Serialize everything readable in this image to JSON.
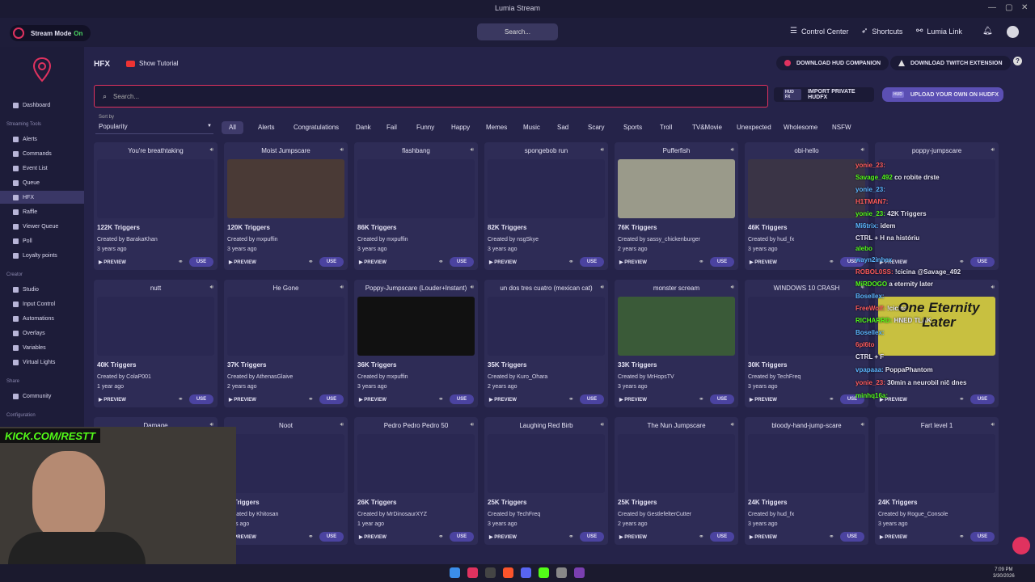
{
  "window": {
    "title": "Lumia Stream"
  },
  "topbar": {
    "stream_mode_label": "Stream Mode",
    "stream_mode_state": "On",
    "search_label": "Search...",
    "control_center": "Control Center",
    "shortcuts": "Shortcuts",
    "lumia_link": "Lumia Link"
  },
  "sidebar": {
    "dashboard": "Dashboard",
    "streaming_tools_header": "Streaming Tools",
    "streaming_tools": [
      "Alerts",
      "Commands",
      "Event List",
      "Queue",
      "HFX",
      "Raffle",
      "Viewer Queue",
      "Poll",
      "Loyalty points"
    ],
    "creator_header": "Creator",
    "creator": [
      "Studio",
      "Input Control",
      "Automations",
      "Overlays",
      "Variables",
      "Virtual Lights"
    ],
    "share_header": "Share",
    "share": [
      "Community"
    ],
    "configuration_header": "Configuration"
  },
  "header": {
    "title": "HFX",
    "tutorial": "Show Tutorial",
    "download_hud": "DOWNLOAD HUD COMPANION",
    "download_twitch": "DOWNLOAD TWITCH EXTENSION",
    "help": "?"
  },
  "search": {
    "placeholder": "Search..."
  },
  "buttons": {
    "import_badge": "HUD FX",
    "import": "IMPORT PRIVATE HUDFX",
    "upload_badge": "HUD",
    "upload": "UPLOAD YOUR OWN ON HUDFX"
  },
  "sort": {
    "label": "Sort by",
    "value": "Popularity"
  },
  "filters": [
    "All",
    "Alerts",
    "Congratulations",
    "Dank",
    "Fail",
    "Funny",
    "Happy",
    "Memes",
    "Music",
    "Sad",
    "Scary",
    "Sports",
    "Troll",
    "TV&Movie",
    "Unexpected",
    "Wholesome",
    "NSFW"
  ],
  "card_labels": {
    "preview": "PREVIEW",
    "use": "USE"
  },
  "cards": [
    {
      "name": "You're breathtaking",
      "triggers": "122K Triggers",
      "by": "Created by BarakaKhan",
      "age": "3 years ago",
      "thumb": "#2a2852"
    },
    {
      "name": "Moist Jumpscare",
      "triggers": "120K Triggers",
      "by": "Created by mxpuffin",
      "age": "3 years ago",
      "thumb": "#4a3a36"
    },
    {
      "name": "flashbang",
      "triggers": "86K Triggers",
      "by": "Created by mxpuffin",
      "age": "3 years ago",
      "thumb": "#2a2852"
    },
    {
      "name": "spongebob run",
      "triggers": "82K Triggers",
      "by": "Created by nsgSkye",
      "age": "3 years ago",
      "thumb": "#2a2852"
    },
    {
      "name": "Pufferfish",
      "triggers": "76K Triggers",
      "by": "Created by sassy_chickenburger",
      "age": "2 years ago",
      "thumb": "#9a9a8a"
    },
    {
      "name": "obi-hello",
      "triggers": "46K Triggers",
      "by": "Created by hud_fx",
      "age": "3 years ago",
      "thumb": "#3a3446"
    },
    {
      "name": "poppy-jumpscare",
      "triggers": "",
      "by": "",
      "age": "",
      "thumb": "#2a2852"
    },
    {
      "name": "nutt",
      "triggers": "40K Triggers",
      "by": "Created by ColaP001",
      "age": "1 year ago",
      "thumb": "#2a2852"
    },
    {
      "name": "He Gone",
      "triggers": "37K Triggers",
      "by": "Created by AthenasGlaive",
      "age": "2 years ago",
      "thumb": "#2a2852"
    },
    {
      "name": "Poppy-Jumpscare (Louder+Instant)",
      "triggers": "36K Triggers",
      "by": "Created by mxpuffin",
      "age": "3 years ago",
      "thumb": "#111111"
    },
    {
      "name": "un dos tres cuatro (mexican cat)",
      "triggers": "35K Triggers",
      "by": "Created by Kuro_Ohara",
      "age": "2 years ago",
      "thumb": "#2a2852"
    },
    {
      "name": "monster scream",
      "triggers": "33K Triggers",
      "by": "Created by MrHopsTV",
      "age": "3 years ago",
      "thumb": "#3a5a38"
    },
    {
      "name": "WINDOWS 10 CRASH",
      "triggers": "30K Triggers",
      "by": "Created by TechFreq",
      "age": "3 years ago",
      "thumb": "#2a2852"
    },
    {
      "name": "",
      "triggers": "",
      "by": "",
      "age": "",
      "thumb": "#c8c040"
    },
    {
      "name": "Damage",
      "triggers": "",
      "by": "",
      "age": "",
      "thumb": "#2a2852"
    },
    {
      "name": "Noot",
      "triggers": "K Triggers",
      "by": "Created by Khitosan",
      "age": "ears ago",
      "thumb": "#2a2852"
    },
    {
      "name": "Pedro Pedro Pedro 50",
      "triggers": "26K Triggers",
      "by": "Created by MrDinosaurXYZ",
      "age": "1 year ago",
      "thumb": "#2a2852"
    },
    {
      "name": "Laughing Red Birb",
      "triggers": "25K Triggers",
      "by": "Created by TechFreq",
      "age": "3 years ago",
      "thumb": "#2a2852"
    },
    {
      "name": "The Nun Jumpscare",
      "triggers": "25K Triggers",
      "by": "Created by GestlefelterCutter",
      "age": "2 years ago",
      "thumb": "#2a2852"
    },
    {
      "name": "bloody-hand-jump-scare",
      "triggers": "24K Triggers",
      "by": "Created by hud_fx",
      "age": "3 years ago",
      "thumb": "#2a2852"
    },
    {
      "name": "Fart level 1",
      "triggers": "24K Triggers",
      "by": "Created by Rogue_Console",
      "age": "3 years ago",
      "thumb": "#2a2852"
    }
  ],
  "overlay": {
    "kick_url": "KICK.COM/RESTT"
  },
  "chat": [
    {
      "user": "yonie_23:",
      "msg": ""
    },
    {
      "user": "Savage_492",
      "msg": "co robite drste"
    },
    {
      "user": "yonie_23:",
      "msg": ""
    },
    {
      "user": "H1TMAN7:",
      "msg": ""
    },
    {
      "user": "yonie_23:",
      "msg": "42K Triggers"
    },
    {
      "user": "Mi6trix:",
      "msg": "idem"
    },
    {
      "user": "",
      "msg": "CTRL + H na históriu"
    },
    {
      "user": "alebo",
      "msg": ""
    },
    {
      "user": "wayn2inhex",
      "msg": ""
    },
    {
      "user": "ROBOL0SS:",
      "msg": "!cicina @Savage_492"
    },
    {
      "user": "MiRDOGO",
      "msg": "a eternity later"
    },
    {
      "user": "Bosellex:",
      "msg": ""
    },
    {
      "user": "FreeWolf:",
      "msg": "!cicina"
    },
    {
      "user": "RICHARRD:",
      "msg": "HNED TLAK"
    },
    {
      "user": "Bosellex:",
      "msg": ""
    },
    {
      "user": "6pl6to",
      "msg": ""
    },
    {
      "user": "",
      "msg": "CTRL + F"
    },
    {
      "user": "vpapaaa:",
      "msg": "PoppaPhantom"
    },
    {
      "user": "yonie_23:",
      "msg": "30min a neurobil nič dnes"
    },
    {
      "user": "minhq16a:",
      "msg": ""
    }
  ],
  "overlay_text": "One Eternity Later",
  "taskbar": {
    "time": "7:09 PM",
    "date": "3/30/2026"
  }
}
